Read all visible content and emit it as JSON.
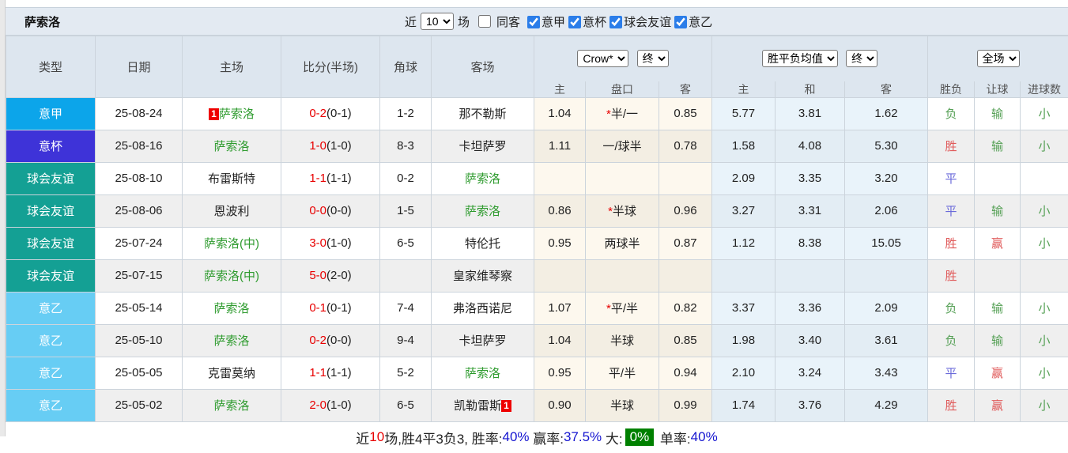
{
  "title": "萨索洛",
  "controls": {
    "recent_label": "近",
    "recent_value": "10",
    "matches_label": "场",
    "same_away_label": "同客",
    "same_away_checked": false,
    "filters": [
      {
        "label": "意甲",
        "checked": true
      },
      {
        "label": "意杯",
        "checked": true
      },
      {
        "label": "球会友谊",
        "checked": true
      },
      {
        "label": "意乙",
        "checked": true
      }
    ]
  },
  "selects": {
    "bookmaker": "Crow*",
    "bookmaker_stage": "终",
    "odds_type": "胜平负均值",
    "odds_stage": "终",
    "scope": "全场"
  },
  "columns": {
    "main": [
      "类型",
      "日期",
      "主场",
      "比分(半场)",
      "角球",
      "客场"
    ],
    "sub": [
      "主",
      "盘口",
      "客",
      "主",
      "和",
      "客",
      "胜负",
      "让球",
      "进球数"
    ]
  },
  "type_colors": {
    "意甲": "#0ca5ea",
    "意杯": "#3e33d8",
    "球会友谊": "#14a094",
    "意乙": "#67cdf4"
  },
  "rows": [
    {
      "type": "意甲",
      "date": "25-08-24",
      "home": {
        "name": "萨索洛",
        "green": true,
        "badge": "1",
        "badge_pos": "before"
      },
      "score_ft": "0-2",
      "score_ht": "(0-1)",
      "corner": "1-2",
      "away": {
        "name": "那不勒斯",
        "green": false
      },
      "ah_home": "1.04",
      "ah_star": true,
      "ah_line": "半/一",
      "ah_away": "0.85",
      "eu_home": "5.77",
      "eu_draw": "3.81",
      "eu_away": "1.62",
      "result": {
        "text": "负",
        "color": "green"
      },
      "handicap": {
        "text": "输",
        "color": "green"
      },
      "goals": {
        "text": "小",
        "color": "green"
      }
    },
    {
      "type": "意杯",
      "date": "25-08-16",
      "home": {
        "name": "萨索洛",
        "green": true
      },
      "score_ft": "1-0",
      "score_ht": "(1-0)",
      "corner": "8-3",
      "away": {
        "name": "卡坦萨罗",
        "green": false
      },
      "ah_home": "1.11",
      "ah_star": false,
      "ah_line": "一/球半",
      "ah_away": "0.78",
      "eu_home": "1.58",
      "eu_draw": "4.08",
      "eu_away": "5.30",
      "result": {
        "text": "胜",
        "color": "red"
      },
      "handicap": {
        "text": "输",
        "color": "green"
      },
      "goals": {
        "text": "小",
        "color": "green"
      }
    },
    {
      "type": "球会友谊",
      "date": "25-08-10",
      "home": {
        "name": "布雷斯特",
        "green": false
      },
      "score_ft": "1-1",
      "score_ht": "(1-1)",
      "corner": "0-2",
      "away": {
        "name": "萨索洛",
        "green": true
      },
      "ah_home": "",
      "ah_star": false,
      "ah_line": "",
      "ah_away": "",
      "eu_home": "2.09",
      "eu_draw": "3.35",
      "eu_away": "3.20",
      "result": {
        "text": "平",
        "color": "blue"
      },
      "handicap": null,
      "goals": null
    },
    {
      "type": "球会友谊",
      "date": "25-08-06",
      "home": {
        "name": "恩波利",
        "green": false
      },
      "score_ft": "0-0",
      "score_ht": "(0-0)",
      "corner": "1-5",
      "away": {
        "name": "萨索洛",
        "green": true
      },
      "ah_home": "0.86",
      "ah_star": true,
      "ah_line": "半球",
      "ah_away": "0.96",
      "eu_home": "3.27",
      "eu_draw": "3.31",
      "eu_away": "2.06",
      "result": {
        "text": "平",
        "color": "blue"
      },
      "handicap": {
        "text": "输",
        "color": "green"
      },
      "goals": {
        "text": "小",
        "color": "green"
      }
    },
    {
      "type": "球会友谊",
      "date": "25-07-24",
      "home": {
        "name": "萨索洛(中)",
        "green": true
      },
      "score_ft": "3-0",
      "score_ht": "(1-0)",
      "corner": "6-5",
      "away": {
        "name": "特伦托",
        "green": false
      },
      "ah_home": "0.95",
      "ah_star": false,
      "ah_line": "两球半",
      "ah_away": "0.87",
      "eu_home": "1.12",
      "eu_draw": "8.38",
      "eu_away": "15.05",
      "result": {
        "text": "胜",
        "color": "red"
      },
      "handicap": {
        "text": "赢",
        "color": "red"
      },
      "goals": {
        "text": "小",
        "color": "green"
      }
    },
    {
      "type": "球会友谊",
      "date": "25-07-15",
      "home": {
        "name": "萨索洛(中)",
        "green": true
      },
      "score_ft": "5-0",
      "score_ht": "(2-0)",
      "corner": "",
      "away": {
        "name": "皇家维琴察",
        "green": false
      },
      "ah_home": "",
      "ah_star": false,
      "ah_line": "",
      "ah_away": "",
      "eu_home": "",
      "eu_draw": "",
      "eu_away": "",
      "result": {
        "text": "胜",
        "color": "red"
      },
      "handicap": null,
      "goals": null
    },
    {
      "type": "意乙",
      "date": "25-05-14",
      "home": {
        "name": "萨索洛",
        "green": true
      },
      "score_ft": "0-1",
      "score_ht": "(0-1)",
      "corner": "7-4",
      "away": {
        "name": "弗洛西诺尼",
        "green": false
      },
      "ah_home": "1.07",
      "ah_star": true,
      "ah_line": "平/半",
      "ah_away": "0.82",
      "eu_home": "3.37",
      "eu_draw": "3.36",
      "eu_away": "2.09",
      "result": {
        "text": "负",
        "color": "green"
      },
      "handicap": {
        "text": "输",
        "color": "green"
      },
      "goals": {
        "text": "小",
        "color": "green"
      }
    },
    {
      "type": "意乙",
      "date": "25-05-10",
      "home": {
        "name": "萨索洛",
        "green": true
      },
      "score_ft": "0-2",
      "score_ht": "(0-0)",
      "corner": "9-4",
      "away": {
        "name": "卡坦萨罗",
        "green": false
      },
      "ah_home": "1.04",
      "ah_star": false,
      "ah_line": "半球",
      "ah_away": "0.85",
      "eu_home": "1.98",
      "eu_draw": "3.40",
      "eu_away": "3.61",
      "result": {
        "text": "负",
        "color": "green"
      },
      "handicap": {
        "text": "输",
        "color": "green"
      },
      "goals": {
        "text": "小",
        "color": "green"
      }
    },
    {
      "type": "意乙",
      "date": "25-05-05",
      "home": {
        "name": "克雷莫纳",
        "green": false
      },
      "score_ft": "1-1",
      "score_ht": "(1-1)",
      "corner": "5-2",
      "away": {
        "name": "萨索洛",
        "green": true
      },
      "ah_home": "0.95",
      "ah_star": false,
      "ah_line": "平/半",
      "ah_away": "0.94",
      "eu_home": "2.10",
      "eu_draw": "3.24",
      "eu_away": "3.43",
      "result": {
        "text": "平",
        "color": "blue"
      },
      "handicap": {
        "text": "赢",
        "color": "red"
      },
      "goals": {
        "text": "小",
        "color": "green"
      }
    },
    {
      "type": "意乙",
      "date": "25-05-02",
      "home": {
        "name": "萨索洛",
        "green": true
      },
      "score_ft": "2-0",
      "score_ht": "(1-0)",
      "corner": "6-5",
      "away": {
        "name": "凯勒雷斯",
        "green": false,
        "badge": "1",
        "badge_pos": "after"
      },
      "ah_home": "0.90",
      "ah_star": false,
      "ah_line": "半球",
      "ah_away": "0.99",
      "eu_home": "1.74",
      "eu_draw": "3.76",
      "eu_away": "4.29",
      "result": {
        "text": "胜",
        "color": "red"
      },
      "handicap": {
        "text": "赢",
        "color": "red"
      },
      "goals": {
        "text": "小",
        "color": "green"
      }
    }
  ],
  "footer": {
    "segments": [
      {
        "text": "近"
      },
      {
        "text": "10",
        "color": "red"
      },
      {
        "text": "场,胜4平3负3, 胜率:"
      },
      {
        "text": "40%",
        "color": "blue"
      },
      {
        "text": " 赢率:"
      },
      {
        "text": "37.5%",
        "color": "blue"
      },
      {
        "text": " 大:"
      },
      {
        "text": "0%",
        "style": "green-badge"
      },
      {
        "text": " 单率:"
      },
      {
        "text": "40%",
        "color": "blue"
      }
    ]
  }
}
